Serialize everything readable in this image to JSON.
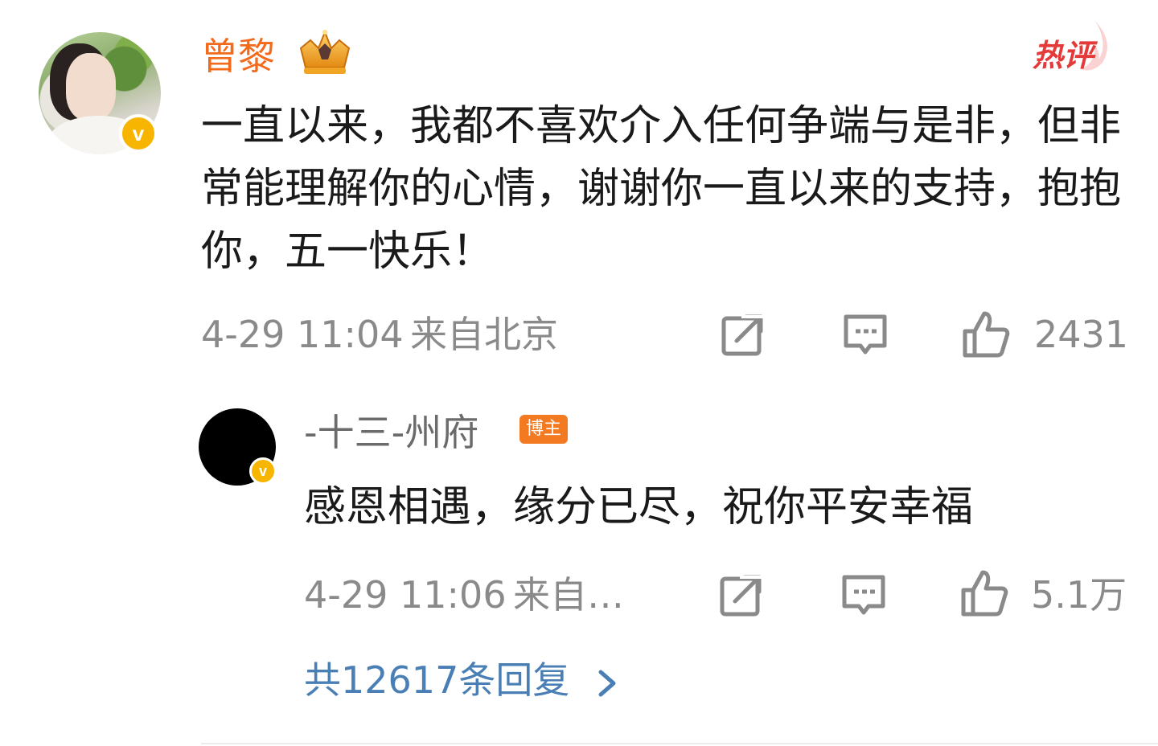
{
  "main_comment": {
    "username": "曾黎",
    "hot_label": "热评",
    "text": "一直以来，我都不喜欢介入任何争端与是非，但非常能理解你的心情，谢谢你一直以来的支持，抱抱你，五一快乐！",
    "time": "4-29 11:04",
    "location": "来自北京",
    "like_count": "2431",
    "icons": {
      "repost": "share-icon",
      "comment": "comment-icon",
      "like": "thumbs-up-icon"
    }
  },
  "reply": {
    "username": "-十三-州府",
    "author_badge": "博主",
    "text": "感恩相遇，缘分已尽，祝你平安幸福",
    "time": "4-29 11:06",
    "location": "来自…",
    "like_count": "5.1万"
  },
  "more_replies": "共12617条回复",
  "colors": {
    "username_main": "#f26a1b",
    "hot_label": "#e53a3a",
    "link_blue": "#4a7fb5",
    "meta_gray": "#8a8a8a",
    "badge_orange": "#f47a22",
    "verify_gold": "#f7b500"
  }
}
